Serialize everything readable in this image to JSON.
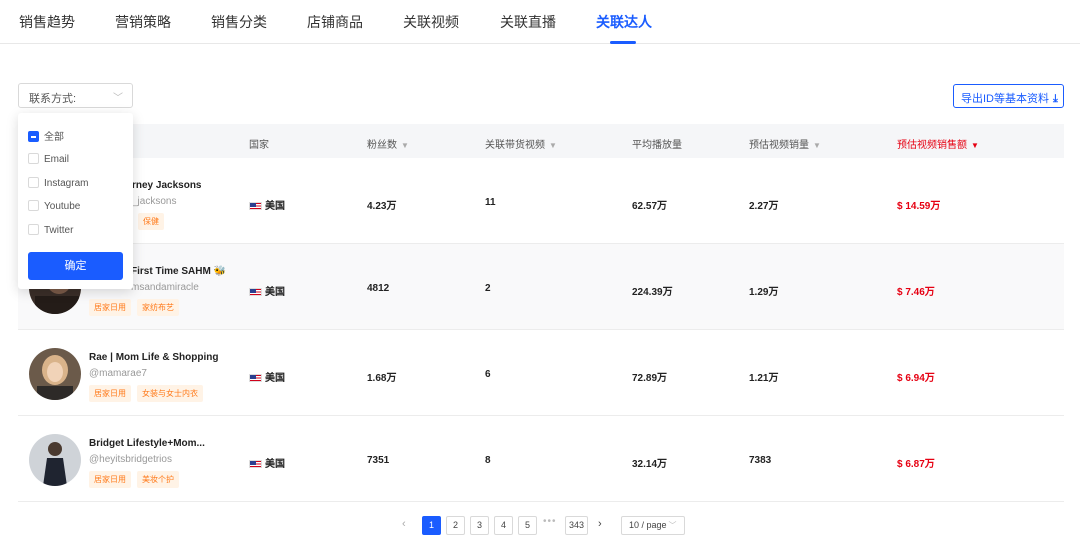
{
  "tabs": [
    "销售趋势",
    "营销策略",
    "销售分类",
    "店铺商品",
    "关联视频",
    "关联直播",
    "关联达人"
  ],
  "active_tab": "关联达人",
  "filter": {
    "label": "联系方式:",
    "options": [
      "全部",
      "Email",
      "Instagram",
      "Youtube",
      "Twitter"
    ],
    "confirm": "确定"
  },
  "export_label": "导出ID等基本资料",
  "headers": {
    "country": "国家",
    "fans": "粉丝数",
    "videos": "关联带货视频",
    "avg_play": "平均播放量",
    "est_sales": "预估视频销量",
    "est_amount": "预估视频销售额"
  },
  "rows": [
    {
      "name": "rney Jacksons",
      "handle": "_jacksons",
      "tags": [
        "保健"
      ],
      "country": "美国",
      "fans": "4.23万",
      "videos": "11",
      "avg_play": "62.57万",
      "est_sales": "2.27万",
      "est_amount": "$ 14.59万"
    },
    {
      "name": "First Time SAHM 🐝",
      "handle": "msandamiracle",
      "tags": [
        "居家日用",
        "家纺布艺"
      ],
      "country": "美国",
      "fans": "4812",
      "videos": "2",
      "avg_play": "224.39万",
      "est_sales": "1.29万",
      "est_amount": "$ 7.46万"
    },
    {
      "name": "Rae | Mom Life & Shopping",
      "handle": "@mamarae7",
      "tags": [
        "居家日用",
        "女装与女士内衣"
      ],
      "country": "美国",
      "fans": "1.68万",
      "videos": "6",
      "avg_play": "72.89万",
      "est_sales": "1.21万",
      "est_amount": "$ 6.94万"
    },
    {
      "name": "Bridget Lifestyle+Mom...",
      "handle": "@heyitsbridgetrios",
      "tags": [
        "居家日用",
        "美妆个护"
      ],
      "country": "美国",
      "fans": "7351",
      "videos": "8",
      "avg_play": "32.14万",
      "est_sales": "7383",
      "est_amount": "$ 6.87万"
    }
  ],
  "pagination": {
    "pages": [
      "1",
      "2",
      "3",
      "4",
      "5"
    ],
    "ellipsis": "•••",
    "last": "343",
    "current": "1",
    "page_size": "10 / page"
  },
  "colors": {
    "accent": "#1a5cff",
    "red": "#e60012",
    "tag_text": "#ff7a1a",
    "tag_bg": "#fff3e6"
  }
}
